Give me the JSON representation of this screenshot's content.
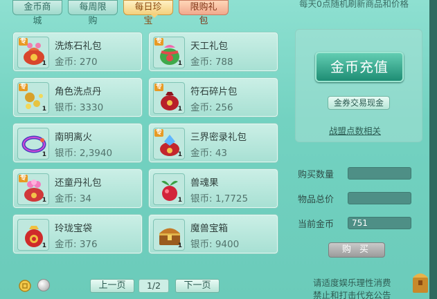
{
  "tabs": [
    {
      "label": "金币商城",
      "state": "normal"
    },
    {
      "label": "每周限购",
      "state": "normal"
    },
    {
      "label": "每日珍宝",
      "state": "active"
    },
    {
      "label": "限购礼包",
      "state": "special"
    }
  ],
  "refresh_note": "每天0点随机刷新商品和价格",
  "items": [
    {
      "name": "洗炼石礼包",
      "price": "金币: 270",
      "icon": "lucky-bag-icon",
      "tag": "专",
      "qty": "1"
    },
    {
      "name": "天工礼包",
      "price": "金币: 788",
      "icon": "gift-bag-icon",
      "tag": "专",
      "qty": "1"
    },
    {
      "name": "角色洗点丹",
      "price": "银币: 3330",
      "icon": "pill-icon",
      "tag": "专",
      "qty": "1"
    },
    {
      "name": "符石碎片包",
      "price": "金币: 256",
      "icon": "red-pouch-icon",
      "tag": "专",
      "qty": "1"
    },
    {
      "name": "南明离火",
      "price": "银币: 2,3940",
      "icon": "fire-ring-icon",
      "tag": "",
      "qty": "1"
    },
    {
      "name": "三界密录礼包",
      "price": "金币: 43",
      "icon": "crystal-bag-icon",
      "tag": "专",
      "qty": "1"
    },
    {
      "name": "还童丹礼包",
      "price": "金币: 34",
      "icon": "flower-bag-icon",
      "tag": "专",
      "qty": "1"
    },
    {
      "name": "兽魂果",
      "price": "银币: 1,7725",
      "icon": "fruit-icon",
      "tag": "",
      "qty": "1"
    },
    {
      "name": "玲珑宝袋",
      "price": "金币: 376",
      "icon": "treasure-pouch-icon",
      "tag": "",
      "qty": "1"
    },
    {
      "name": "魔兽宝箱",
      "price": "银币: 9400",
      "icon": "treasure-chest-icon",
      "tag": "",
      "qty": "1"
    }
  ],
  "recharge": {
    "button_label": "金币充值",
    "exchange_label": "金券交易现金",
    "league_link": "战盟点数相关"
  },
  "purchase": {
    "qty_label": "购买数量",
    "qty_value": "",
    "total_label": "物品总价",
    "total_value": "",
    "balance_label": "当前金币",
    "balance_value": "751",
    "buy_label": "购 买"
  },
  "pager": {
    "prev_label": "上一页",
    "page": "1/2",
    "next_label": "下一页"
  },
  "notice": {
    "line1": "请适度娱乐理性消费",
    "line2": "禁止和打击代充公告"
  },
  "colors": {
    "panel_bg": "#73d2c1",
    "active_tab": "#f4d07c",
    "special_tab": "#f1a98d",
    "recharge_button": "#1e8d74"
  }
}
